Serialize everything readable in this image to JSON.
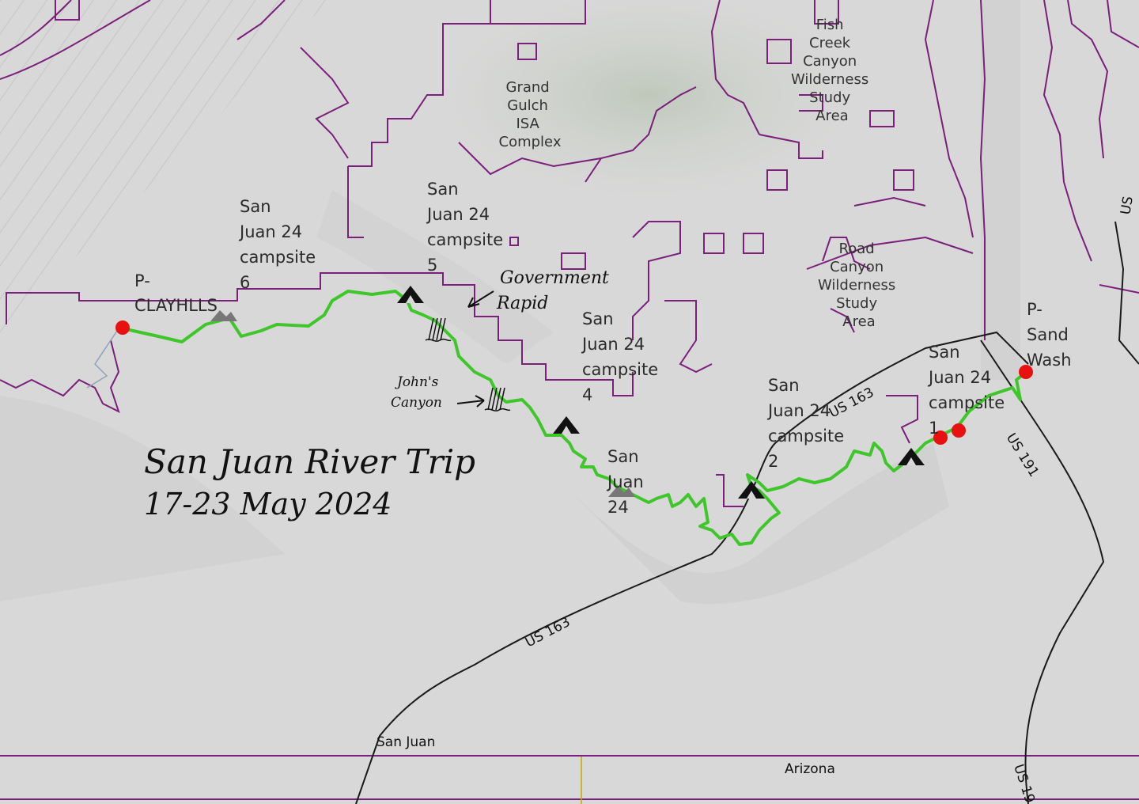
{
  "map": {
    "title_line1": "San Juan River Trip",
    "title_line2": "17-23 May 2024",
    "annotations": {
      "government_rapid_1": "Government",
      "government_rapid_2": "Rapid",
      "johns_canyon_1": "John's",
      "johns_canyon_2": "Canyon"
    },
    "areas": {
      "fish_creek": [
        "Fish",
        "Creek",
        "Canyon",
        "Wilderness",
        "Study",
        "Area"
      ],
      "grand_gulch": [
        "Grand",
        "Gulch",
        "ISA",
        "Complex"
      ],
      "road_canyon": [
        "Road",
        "Canyon",
        "Wilderness",
        "Study",
        "Area"
      ]
    },
    "waypoints": {
      "clayhills": [
        "P-",
        "CLAYHLLS"
      ],
      "sand_wash": [
        "P-",
        "Sand",
        "Wash"
      ],
      "campsite_6": [
        "San",
        "Juan 24",
        "campsite",
        "6"
      ],
      "campsite_5": [
        "San",
        "Juan 24",
        "campsite",
        "5"
      ],
      "campsite_4": [
        "San",
        "Juan 24",
        "campsite",
        "4"
      ],
      "campsite_2": [
        "San",
        "Juan 24",
        "campsite",
        "2"
      ],
      "campsite_1": [
        "San",
        "Juan 24",
        "campsite",
        "1"
      ],
      "san_juan_24": [
        "San",
        "Juan",
        "24"
      ]
    },
    "roads": {
      "us163_a": "US 163",
      "us163_b": "US 163",
      "us191_a": "US 191",
      "us191_b": "US 19",
      "us_top": "US"
    },
    "places": {
      "county": "San Juan",
      "state": "Arizona"
    },
    "colors": {
      "route": "#3fc62b",
      "boundary": "#7a1f7a",
      "road": "#1a1a1a",
      "marker": "#e81010",
      "terrain": "#d9d9d9"
    },
    "icons": {
      "campsite": "tent-icon",
      "trailhead": "mountain-icon",
      "rapid": "rapid-icon",
      "point": "red-dot-icon"
    }
  }
}
